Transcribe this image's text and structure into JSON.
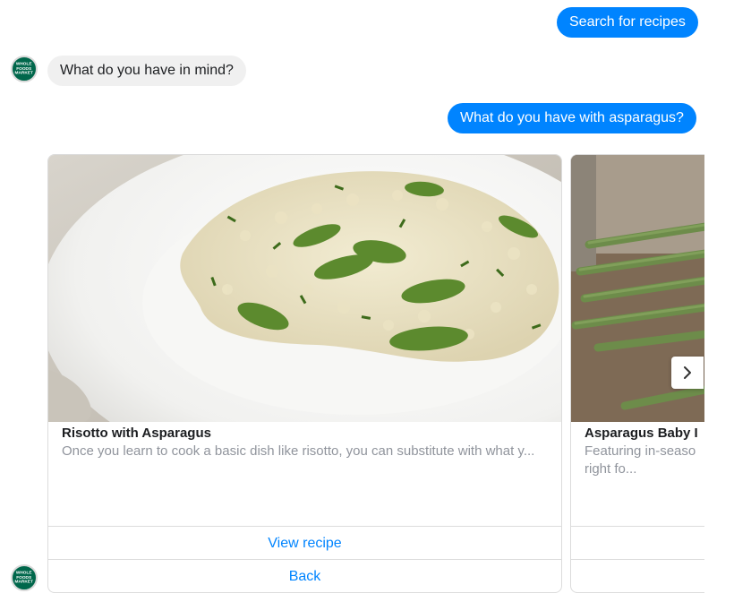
{
  "messages": {
    "user_1": "Search for recipes",
    "bot_1": "What do you have in mind?",
    "user_2": "What do you have with asparagus?"
  },
  "avatar": {
    "text": "WHOLE FOODS MARKET",
    "color": "#00674b"
  },
  "carousel": {
    "cards": [
      {
        "title": "Risotto with Asparagus",
        "subtitle": "Once you learn to cook a basic dish like risotto, you can substitute with what y...",
        "buttons": [
          "View recipe",
          "Back"
        ]
      },
      {
        "title": "Asparagus Baby I",
        "subtitle": "Featuring in-seaso right fo..."
      }
    ],
    "next_icon": "chevron-right-icon"
  },
  "colors": {
    "accent": "#0084ff",
    "bubble_in": "#f0f0f0",
    "muted": "#90949c"
  }
}
